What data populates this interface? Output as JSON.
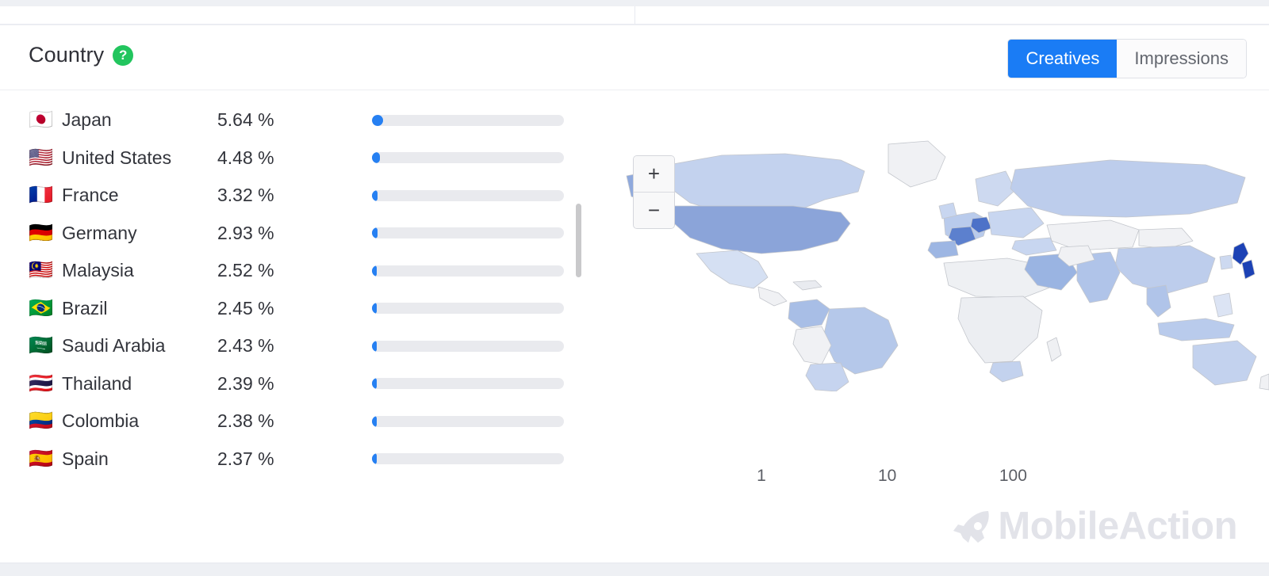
{
  "header": {
    "title": "Country",
    "help_icon": "question-mark-icon",
    "toggle": {
      "options": [
        {
          "label": "Creatives",
          "active": true
        },
        {
          "label": "Impressions",
          "active": false
        }
      ]
    }
  },
  "countries": [
    {
      "flag": "🇯🇵",
      "name": "Japan",
      "pct": "5.64 %",
      "bar_pct": 5.9
    },
    {
      "flag": "🇺🇸",
      "name": "United States",
      "pct": "4.48 %",
      "bar_pct": 4.3
    },
    {
      "flag": "🇫🇷",
      "name": "France",
      "pct": "3.32 %",
      "bar_pct": 3.0
    },
    {
      "flag": "🇩🇪",
      "name": "Germany",
      "pct": "2.93 %",
      "bar_pct": 2.7
    },
    {
      "flag": "🇲🇾",
      "name": "Malaysia",
      "pct": "2.52 %",
      "bar_pct": 2.3
    },
    {
      "flag": "🇧🇷",
      "name": "Brazil",
      "pct": "2.45 %",
      "bar_pct": 2.2
    },
    {
      "flag": "🇸🇦",
      "name": "Saudi Arabia",
      "pct": "2.43 %",
      "bar_pct": 2.2
    },
    {
      "flag": "🇹🇭",
      "name": "Thailand",
      "pct": "2.39 %",
      "bar_pct": 2.1
    },
    {
      "flag": "🇨🇴",
      "name": "Colombia",
      "pct": "2.38 %",
      "bar_pct": 2.1
    },
    {
      "flag": "🇪🇸",
      "name": "Spain",
      "pct": "2.37 %",
      "bar_pct": 2.1
    }
  ],
  "map": {
    "zoom_in_label": "+",
    "zoom_out_label": "−",
    "legend": {
      "ticks": [
        {
          "label": "1",
          "position": 0
        },
        {
          "label": "10",
          "position": 46
        },
        {
          "label": "100",
          "position": 92
        }
      ]
    }
  },
  "watermark": {
    "text": "MobileAction",
    "icon": "rocket-icon"
  },
  "colors": {
    "accent_blue": "#1a7cf5",
    "bar_blue": "#2680f2",
    "help_green": "#22c55e",
    "track_gray": "#e9eaee",
    "watermark_gray": "#e2e3e9"
  }
}
